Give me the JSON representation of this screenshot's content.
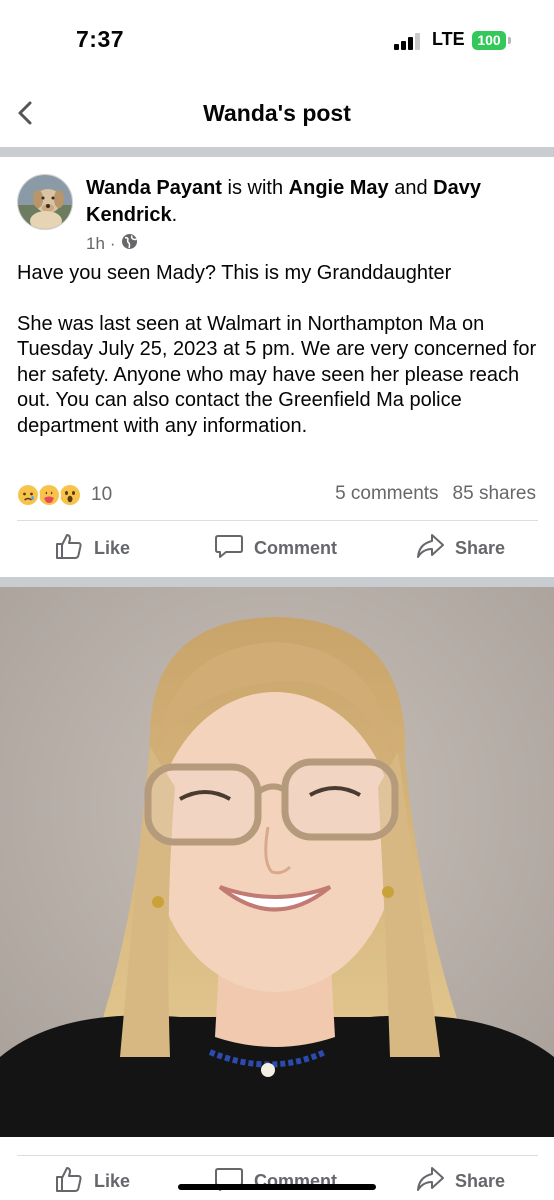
{
  "status_bar": {
    "time": "7:37",
    "network": "LTE",
    "battery": "100"
  },
  "header": {
    "title": "Wanda's post"
  },
  "post": {
    "author": "Wanda Payant",
    "with_text": " is with ",
    "tag1": "Angie May",
    "and_text": " and ",
    "tag2": "Davy Kendrick",
    "period": ".",
    "time": "1h",
    "dot": "·",
    "paragraph1": "Have you seen Mady? This is my Granddaughter",
    "paragraph2": "She was last seen at Walmart in Northampton Ma on Tuesday July 25, 2023 at 5 pm.  We are very concerned for her safety. Anyone who may have seen her please reach out. You can also contact the Greenfield Ma police department with any information.",
    "reaction_count": "10",
    "comments": "5 comments",
    "shares": "85 shares"
  },
  "actions": {
    "like": "Like",
    "comment": "Comment",
    "share": "Share"
  },
  "bottom_actions": {
    "like": "Like",
    "comment": "Comment",
    "share": "Share"
  },
  "colors": {
    "text": "#050505",
    "secondary": "#65676b",
    "divider": "#c9ccd1",
    "battery": "#34c759"
  },
  "icons": [
    "back-chevron-icon",
    "globe-icon",
    "sad-reaction-icon",
    "care-reaction-icon",
    "wow-reaction-icon",
    "like-thumb-icon",
    "comment-bubble-icon",
    "share-arrow-icon"
  ]
}
